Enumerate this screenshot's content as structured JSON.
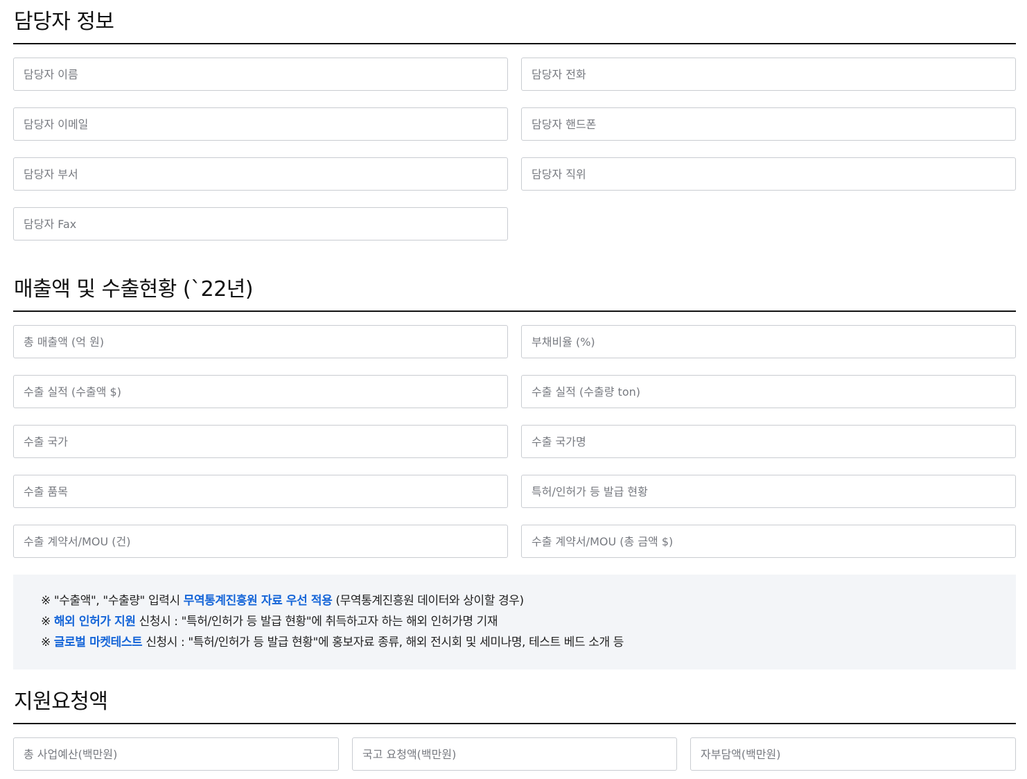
{
  "contact": {
    "title": "담당자 정보",
    "fields": {
      "name": "담당자 이름",
      "phone": "담당자 전화",
      "email": "담당자 이메일",
      "mobile": "담당자 핸드폰",
      "department": "담당자 부서",
      "position": "담당자 직위",
      "fax": "담당자 Fax"
    }
  },
  "sales": {
    "title": "매출액 및 수출현황 (`22년)",
    "fields": {
      "total_sales": "총 매출액 (억 원)",
      "debt_ratio": "부채비율 (%)",
      "export_amount": "수출 실적 (수출액 $)",
      "export_volume": "수출 실적 (수출량 ton)",
      "export_country": "수출 국가",
      "export_country_name": "수출 국가명",
      "export_item": "수출 품목",
      "patent_status": "특허/인허가 등 발급 현황",
      "contract_count": "수출 계약서/MOU (건)",
      "contract_amount": "수출 계약서/MOU (총 금액 $)"
    }
  },
  "notice": {
    "line1": {
      "prefix": "※ \"수출액\", \"수출량\" 입력시 ",
      "highlight": "무역통계진흥원 자료 우선 적용",
      "suffix": " (무역통계진흥원 데이터와 상이할 경우)"
    },
    "line2": {
      "prefix": "※ ",
      "highlight": "해외 인허가 지원",
      "suffix": " 신청시 : \"특허/인허가 등 발급 현황\"에 취득하고자 하는 해외 인허가명 기재"
    },
    "line3": {
      "prefix": "※ ",
      "highlight": "글로벌 마켓테스트",
      "suffix": " 신청시 : \"특허/인허가 등 발급 현황\"에 홍보자료 종류, 해외 전시회 및 세미나명, 테스트 베드 소개 등"
    },
    "highlight_color": "#1565d8"
  },
  "support": {
    "title": "지원요청액",
    "fields": {
      "total_budget": "총 사업예산(백만원)",
      "gov_request": "국고 요청액(백만원)",
      "self_pay": "자부담액(백만원)"
    }
  }
}
